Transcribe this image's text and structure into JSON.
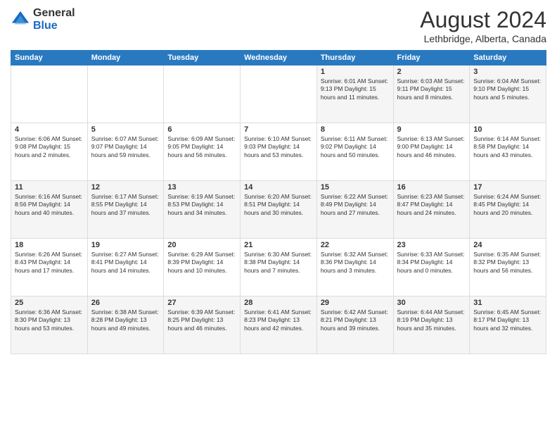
{
  "header": {
    "logo": {
      "general": "General",
      "blue": "Blue"
    },
    "month_year": "August 2024",
    "location": "Lethbridge, Alberta, Canada"
  },
  "days_of_week": [
    "Sunday",
    "Monday",
    "Tuesday",
    "Wednesday",
    "Thursday",
    "Friday",
    "Saturday"
  ],
  "weeks": [
    [
      {
        "day": "",
        "info": ""
      },
      {
        "day": "",
        "info": ""
      },
      {
        "day": "",
        "info": ""
      },
      {
        "day": "",
        "info": ""
      },
      {
        "day": "1",
        "info": "Sunrise: 6:01 AM\nSunset: 9:13 PM\nDaylight: 15 hours\nand 11 minutes."
      },
      {
        "day": "2",
        "info": "Sunrise: 6:03 AM\nSunset: 9:11 PM\nDaylight: 15 hours\nand 8 minutes."
      },
      {
        "day": "3",
        "info": "Sunrise: 6:04 AM\nSunset: 9:10 PM\nDaylight: 15 hours\nand 5 minutes."
      }
    ],
    [
      {
        "day": "4",
        "info": "Sunrise: 6:06 AM\nSunset: 9:08 PM\nDaylight: 15 hours\nand 2 minutes."
      },
      {
        "day": "5",
        "info": "Sunrise: 6:07 AM\nSunset: 9:07 PM\nDaylight: 14 hours\nand 59 minutes."
      },
      {
        "day": "6",
        "info": "Sunrise: 6:09 AM\nSunset: 9:05 PM\nDaylight: 14 hours\nand 56 minutes."
      },
      {
        "day": "7",
        "info": "Sunrise: 6:10 AM\nSunset: 9:03 PM\nDaylight: 14 hours\nand 53 minutes."
      },
      {
        "day": "8",
        "info": "Sunrise: 6:11 AM\nSunset: 9:02 PM\nDaylight: 14 hours\nand 50 minutes."
      },
      {
        "day": "9",
        "info": "Sunrise: 6:13 AM\nSunset: 9:00 PM\nDaylight: 14 hours\nand 46 minutes."
      },
      {
        "day": "10",
        "info": "Sunrise: 6:14 AM\nSunset: 8:58 PM\nDaylight: 14 hours\nand 43 minutes."
      }
    ],
    [
      {
        "day": "11",
        "info": "Sunrise: 6:16 AM\nSunset: 8:56 PM\nDaylight: 14 hours\nand 40 minutes."
      },
      {
        "day": "12",
        "info": "Sunrise: 6:17 AM\nSunset: 8:55 PM\nDaylight: 14 hours\nand 37 minutes."
      },
      {
        "day": "13",
        "info": "Sunrise: 6:19 AM\nSunset: 8:53 PM\nDaylight: 14 hours\nand 34 minutes."
      },
      {
        "day": "14",
        "info": "Sunrise: 6:20 AM\nSunset: 8:51 PM\nDaylight: 14 hours\nand 30 minutes."
      },
      {
        "day": "15",
        "info": "Sunrise: 6:22 AM\nSunset: 8:49 PM\nDaylight: 14 hours\nand 27 minutes."
      },
      {
        "day": "16",
        "info": "Sunrise: 6:23 AM\nSunset: 8:47 PM\nDaylight: 14 hours\nand 24 minutes."
      },
      {
        "day": "17",
        "info": "Sunrise: 6:24 AM\nSunset: 8:45 PM\nDaylight: 14 hours\nand 20 minutes."
      }
    ],
    [
      {
        "day": "18",
        "info": "Sunrise: 6:26 AM\nSunset: 8:43 PM\nDaylight: 14 hours\nand 17 minutes."
      },
      {
        "day": "19",
        "info": "Sunrise: 6:27 AM\nSunset: 8:41 PM\nDaylight: 14 hours\nand 14 minutes."
      },
      {
        "day": "20",
        "info": "Sunrise: 6:29 AM\nSunset: 8:39 PM\nDaylight: 14 hours\nand 10 minutes."
      },
      {
        "day": "21",
        "info": "Sunrise: 6:30 AM\nSunset: 8:38 PM\nDaylight: 14 hours\nand 7 minutes."
      },
      {
        "day": "22",
        "info": "Sunrise: 6:32 AM\nSunset: 8:36 PM\nDaylight: 14 hours\nand 3 minutes."
      },
      {
        "day": "23",
        "info": "Sunrise: 6:33 AM\nSunset: 8:34 PM\nDaylight: 14 hours\nand 0 minutes."
      },
      {
        "day": "24",
        "info": "Sunrise: 6:35 AM\nSunset: 8:32 PM\nDaylight: 13 hours\nand 56 minutes."
      }
    ],
    [
      {
        "day": "25",
        "info": "Sunrise: 6:36 AM\nSunset: 8:30 PM\nDaylight: 13 hours\nand 53 minutes."
      },
      {
        "day": "26",
        "info": "Sunrise: 6:38 AM\nSunset: 8:28 PM\nDaylight: 13 hours\nand 49 minutes."
      },
      {
        "day": "27",
        "info": "Sunrise: 6:39 AM\nSunset: 8:25 PM\nDaylight: 13 hours\nand 46 minutes."
      },
      {
        "day": "28",
        "info": "Sunrise: 6:41 AM\nSunset: 8:23 PM\nDaylight: 13 hours\nand 42 minutes."
      },
      {
        "day": "29",
        "info": "Sunrise: 6:42 AM\nSunset: 8:21 PM\nDaylight: 13 hours\nand 39 minutes."
      },
      {
        "day": "30",
        "info": "Sunrise: 6:44 AM\nSunset: 8:19 PM\nDaylight: 13 hours\nand 35 minutes."
      },
      {
        "day": "31",
        "info": "Sunrise: 6:45 AM\nSunset: 8:17 PM\nDaylight: 13 hours\nand 32 minutes."
      }
    ]
  ]
}
